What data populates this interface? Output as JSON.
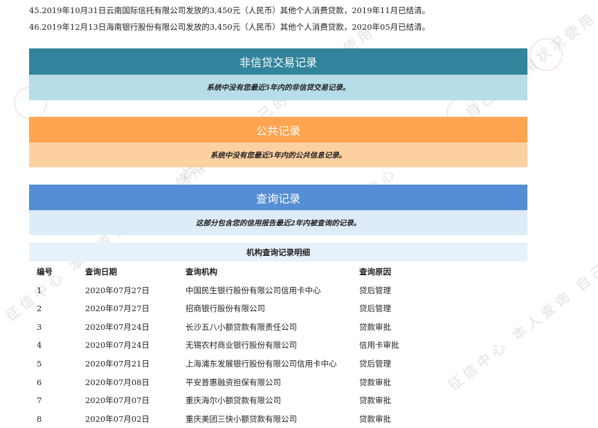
{
  "top_lines": [
    "45.2019年10月31日云南国际信托有限公司发放的3,450元（人民币）其他个人消费贷款，2019年11月已结清。",
    "46.2019年12月13日海南银行股份有限公司发放的3,450元（人民币）其他个人消费贷款，2020年05月已结清。"
  ],
  "sections": {
    "non_credit": {
      "title": "非信贷交易记录",
      "note": "系统中没有您最近5年内的非信贷交易记录。",
      "title_color": "#31849b",
      "note_color": "#b7dde8"
    },
    "public": {
      "title": "公共记录",
      "note": "系统中没有您最近5年内的公共信息记录。",
      "title_color": "#ffa44f",
      "note_color": "#fdd0a2"
    },
    "inquiry": {
      "title": "查询记录",
      "note": "这部分包含您的信用报告最近2年内被查询的记录。",
      "title_color": "#558ed5",
      "note_color": "#deebf9"
    }
  },
  "inquiry_detail": {
    "heading": "机构查询记录明细",
    "columns": [
      "编号",
      "查询日期",
      "查询机构",
      "查询原因"
    ],
    "rows": [
      [
        "1",
        "2020年07月27日",
        "中国民生银行股份有限公司信用卡中心",
        "贷后管理"
      ],
      [
        "2",
        "2020年07月27日",
        "招商银行股份有限公司",
        "贷后管理"
      ],
      [
        "3",
        "2020年07月24日",
        "长沙五八小额贷款有限责任公司",
        "贷款审批"
      ],
      [
        "4",
        "2020年07月24日",
        "无锡农村商业银行股份有限公司",
        "信用卡审批"
      ],
      [
        "5",
        "2020年07月21日",
        "上海浦东发展银行股份有限公司信用卡中心",
        "贷后管理"
      ],
      [
        "6",
        "2020年07月08日",
        "平安普惠融资担保有限公司",
        "贷款审批"
      ],
      [
        "7",
        "2020年07月07日",
        "重庆海尔小额贷款有限公司",
        "贷款审批"
      ],
      [
        "8",
        "2020年07月02日",
        "重庆美团三快小额贷款有限公司",
        "贷款审批"
      ]
    ]
  },
  "watermark_text": "征信中心 本人查询 自己的信用状况使用"
}
